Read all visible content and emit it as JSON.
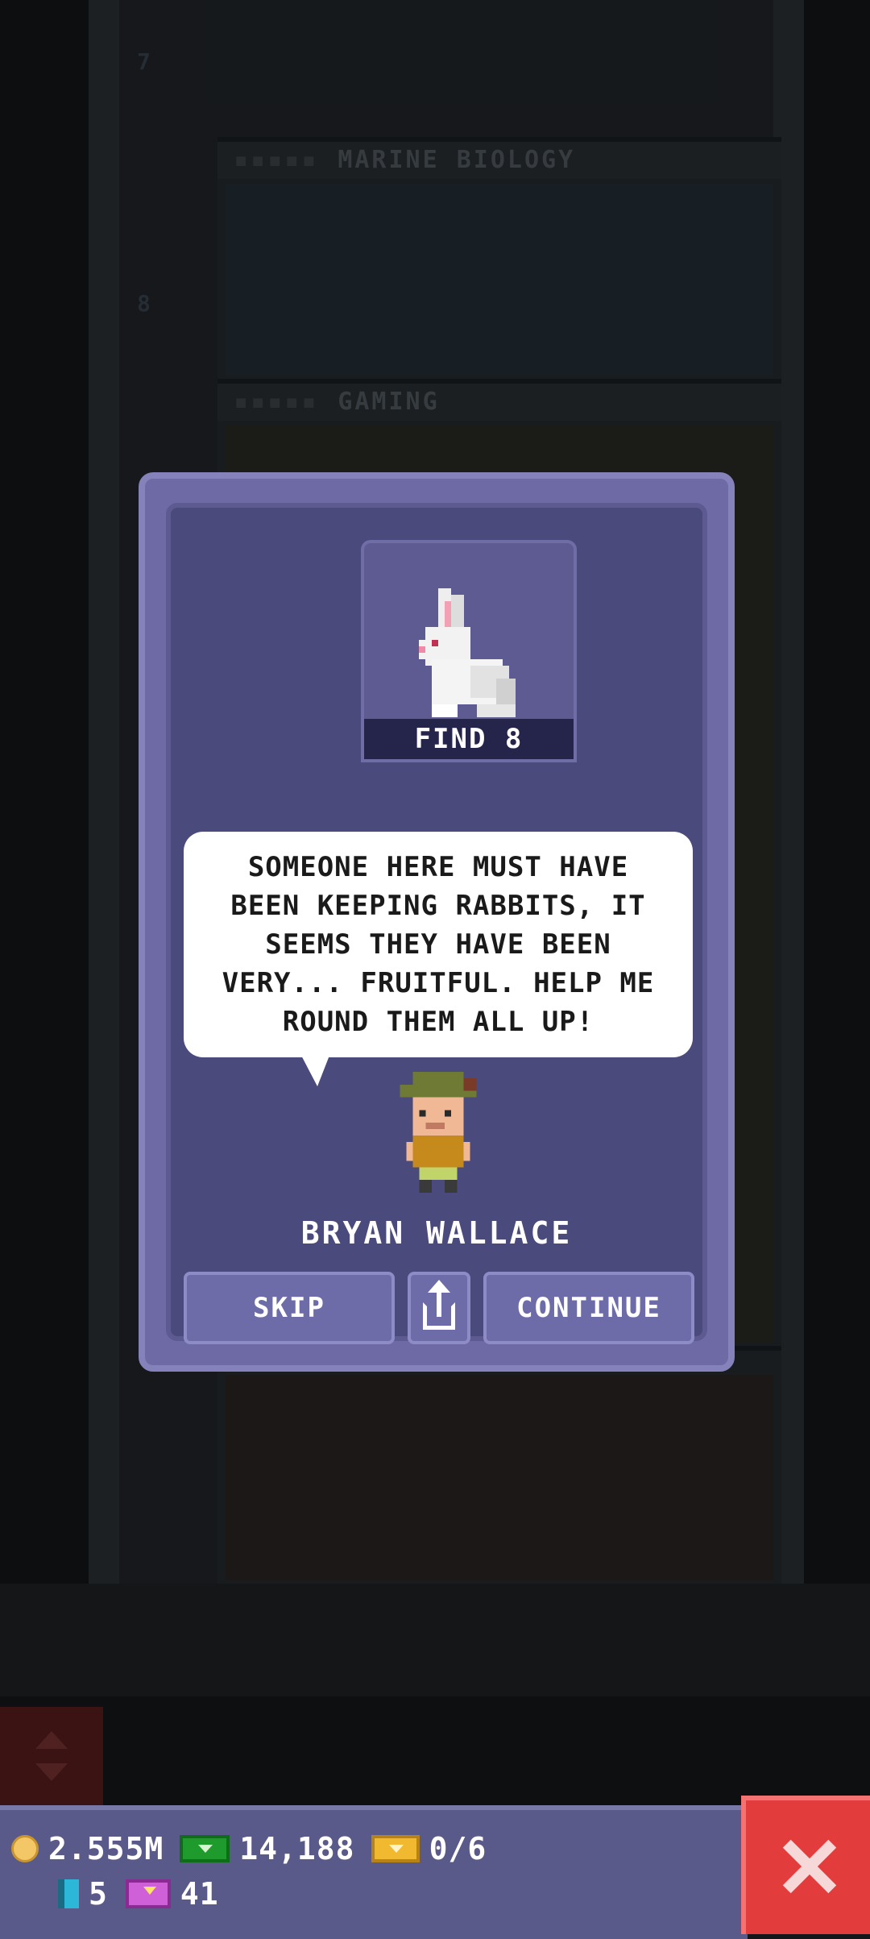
{
  "background": {
    "floors": [
      {
        "name": "MARINE BIOLOGY",
        "number": "8"
      },
      {
        "name": "GAMING",
        "number": ""
      }
    ],
    "top_floor_number": "7"
  },
  "mission": {
    "reward_icon": "rabbit-icon",
    "reward_label": "FIND 8",
    "speech_text": "SOMEONE HERE MUST HAVE BEEN KEEPING RABBITS, IT SEEMS THEY HAVE BEEN VERY... FRUITFUL. HELP ME ROUND THEM ALL UP!",
    "npc_name": "BRYAN WALLACE",
    "buttons": {
      "skip": "SKIP",
      "share_icon": "share-icon",
      "continue": "CONTINUE"
    }
  },
  "hud": {
    "coins": "2.555M",
    "bux": "14,188",
    "tickets": "0/6",
    "cards": "5",
    "gifts": "41"
  },
  "colors": {
    "dialog_bg": "#4a4a7c",
    "dialog_border": "#6d6aa6",
    "hud_bg": "#5a5a8a",
    "close_button": "#e23c3c"
  }
}
